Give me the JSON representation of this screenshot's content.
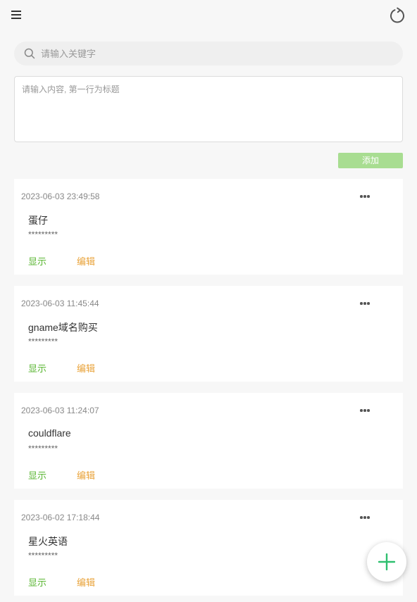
{
  "search": {
    "placeholder": "请输入关键字"
  },
  "editor": {
    "placeholder": "请输入内容, 第一行为标题"
  },
  "add_button_label": "添加",
  "entries": [
    {
      "time": "2023-06-03 23:49:58",
      "title": "蛋仔",
      "masked": "*********",
      "show_label": "显示",
      "edit_label": "编辑"
    },
    {
      "time": "2023-06-03 11:45:44",
      "title": "gname域名购买",
      "masked": "*********",
      "show_label": "显示",
      "edit_label": "编辑"
    },
    {
      "time": "2023-06-03 11:24:07",
      "title": "couldflare",
      "masked": "*********",
      "show_label": "显示",
      "edit_label": "编辑"
    },
    {
      "time": "2023-06-02 17:18:44",
      "title": "星火英语",
      "masked": "*********",
      "show_label": "显示",
      "edit_label": "编辑"
    }
  ],
  "colors": {
    "background": "#f7f7f7",
    "add_button": "#a8dd91",
    "show_link": "#58b530",
    "edit_link": "#e9a33a",
    "fab_plus": "#2fbf6f"
  },
  "icons": {
    "menu": "menu-icon",
    "refresh": "refresh-icon",
    "search": "search-icon",
    "more": "more-horizontal-icon",
    "add": "plus-icon"
  }
}
